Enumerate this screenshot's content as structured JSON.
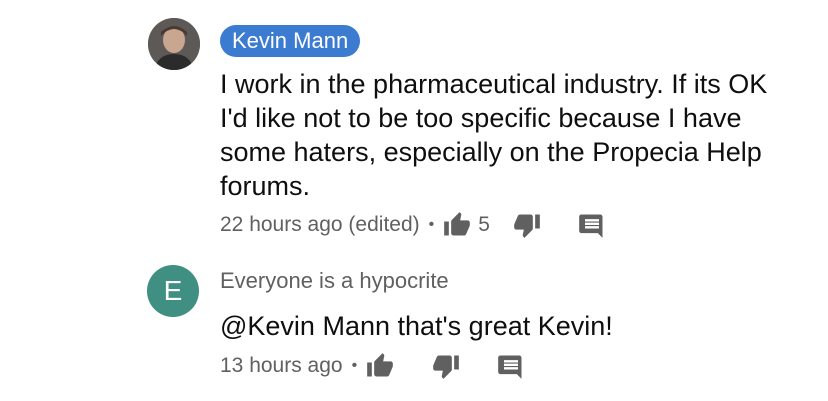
{
  "comments": [
    {
      "author": "Kevin Mann",
      "avatar_letter": "",
      "text": "I work in the pharmaceutical industry.  If its OK I'd like not to be too specific because I have some haters, especially on the Propecia Help forums.",
      "timestamp": "22 hours ago (edited)",
      "separator": "•",
      "likes": "5",
      "icons": [
        "thumbs-up-icon",
        "thumbs-down-icon",
        "reply-icon"
      ]
    },
    {
      "author": "Everyone is a hypocrite",
      "avatar_letter": "E",
      "text": "@Kevin Mann that's great Kevin!",
      "timestamp": "13 hours ago",
      "separator": "•",
      "likes": "",
      "icons": [
        "thumbs-up-icon",
        "thumbs-down-icon",
        "reply-icon"
      ]
    }
  ],
  "colors": {
    "author_chip": "#3b7bd0",
    "avatar_e": "#3f8f83",
    "meta_text": "#606060"
  }
}
